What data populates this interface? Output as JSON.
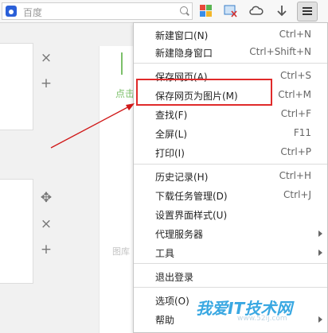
{
  "toolbar": {
    "search_placeholder": "百度",
    "icons": [
      "baidu-icon",
      "search-icon",
      "apps-icon",
      "screenshot-icon",
      "cloud-icon",
      "download-icon",
      "menu-icon"
    ]
  },
  "background": {
    "left_buttons": [
      "×",
      "+",
      "✥",
      "×",
      "+"
    ],
    "green_text": "点击",
    "faded_text": "图库"
  },
  "menu": {
    "items": [
      {
        "label": "新建窗口(N)",
        "shortcut": "Ctrl+N"
      },
      {
        "label": "新建隐身窗口",
        "shortcut": "Ctrl+Shift+N"
      },
      {
        "label": "保存网页(A)",
        "shortcut": "Ctrl+S"
      },
      {
        "label": "保存网页为图片(M)",
        "shortcut": "Ctrl+M"
      },
      {
        "label": "查找(F)",
        "shortcut": "Ctrl+F"
      },
      {
        "label": "全屏(L)",
        "shortcut": "F11"
      },
      {
        "label": "打印(I)",
        "shortcut": "Ctrl+P"
      },
      {
        "label": "历史记录(H)",
        "shortcut": "Ctrl+H"
      },
      {
        "label": "下载任务管理(D)",
        "shortcut": "Ctrl+J"
      },
      {
        "label": "设置界面样式(U)",
        "shortcut": ""
      },
      {
        "label": "代理服务器",
        "shortcut": ""
      },
      {
        "label": "工具",
        "shortcut": ""
      },
      {
        "label": "退出登录",
        "shortcut": ""
      },
      {
        "label": "选项(O)",
        "shortcut": ""
      },
      {
        "label": "帮助",
        "shortcut": ""
      }
    ]
  },
  "watermark": {
    "text": "我爱IT技术网",
    "url": "www.52ij.com"
  },
  "colors": {
    "highlight": "#e02a2a",
    "arrow": "#d01818",
    "accent_green": "#7cc06a",
    "watermark": "#3aa8e2"
  }
}
